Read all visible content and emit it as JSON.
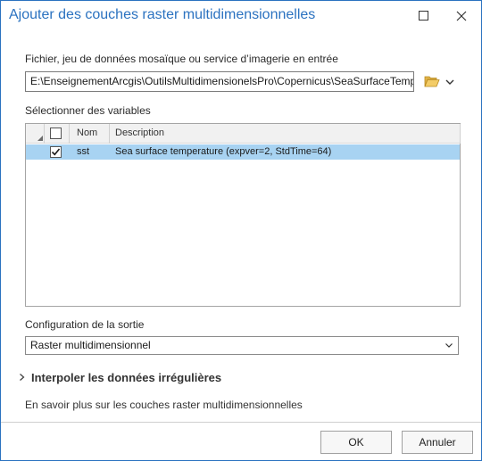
{
  "window": {
    "title": "Ajouter des couches raster multidimensionnelles"
  },
  "input": {
    "label": "Fichier, jeu de données mosaïque ou service d’imagerie en entrée",
    "value": "E:\\EnseignementArcgis\\OutilsMultidimensionelsPro\\Copernicus\\SeaSurfaceTemp"
  },
  "variables": {
    "label": "Sélectionner des variables",
    "columns": {
      "name": "Nom",
      "description": "Description"
    },
    "rows": [
      {
        "checked": true,
        "name": "sst",
        "description": "Sea surface temperature (expver=2, StdTime=64)"
      }
    ]
  },
  "output": {
    "label": "Configuration de la sortie",
    "selected": "Raster multidimensionnel"
  },
  "expander": {
    "label": "Interpoler les données irrégulières"
  },
  "help_link": "En savoir plus sur les couches raster multidimensionnelles",
  "buttons": {
    "ok": "OK",
    "cancel": "Annuler"
  },
  "colors": {
    "accent": "#2b72c0",
    "selected_row": "#a8d3f2"
  }
}
